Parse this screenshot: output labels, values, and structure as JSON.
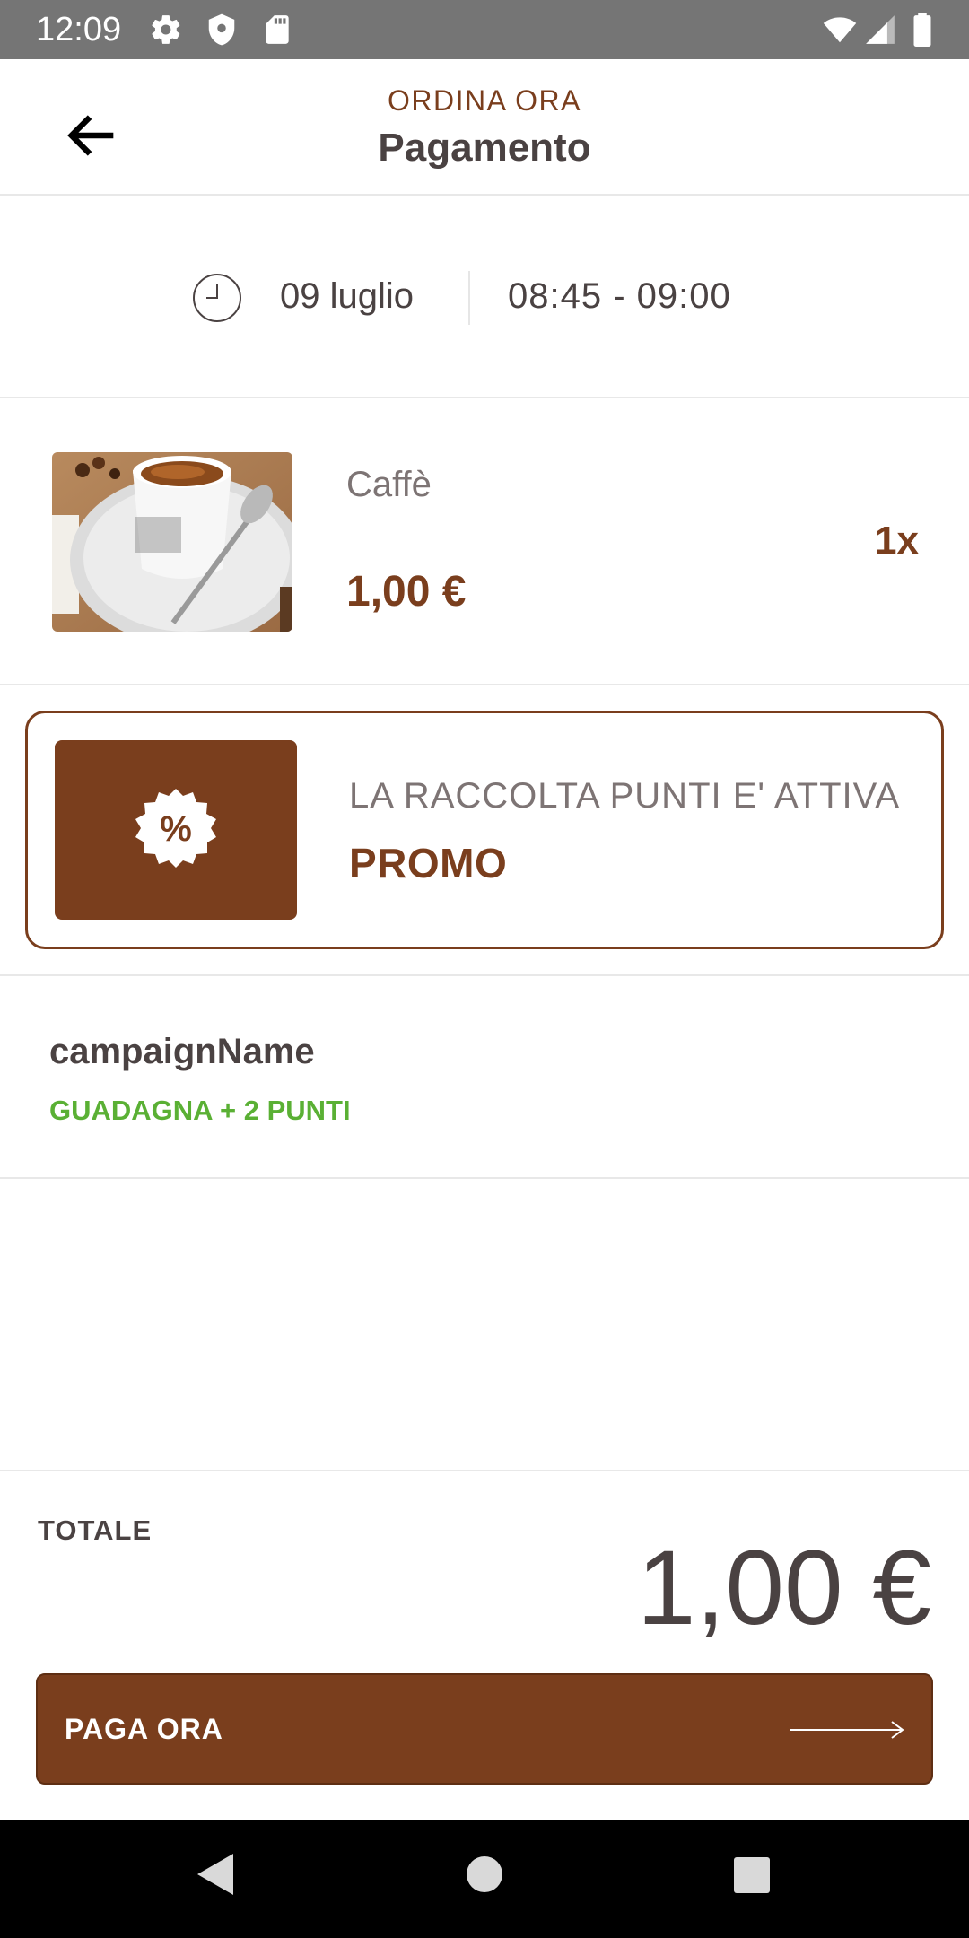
{
  "status_bar": {
    "time": "12:09",
    "left_icons": [
      "gear-icon",
      "shield-icon",
      "sd-card-icon"
    ],
    "right_icons": [
      "wifi-icon",
      "signal-icon",
      "battery-icon"
    ]
  },
  "header": {
    "subtitle": "ORDINA ORA",
    "title": "Pagamento",
    "back_icon": "arrow-left-icon"
  },
  "timeslot": {
    "icon": "clock-icon",
    "date": "09 luglio",
    "time": "08:45 - 09:00"
  },
  "product": {
    "name": "Caffè",
    "price": "1,00 €",
    "quantity": "1x"
  },
  "promo": {
    "icon": "percent-badge-icon",
    "caption": "LA RACCOLTA PUNTI E' ATTIVA",
    "title": "PROMO"
  },
  "campaign": {
    "name": "campaignName",
    "points": "GUADAGNA + 2 PUNTI"
  },
  "footer": {
    "total_label": "TOTALE",
    "total_value": "1,00 €",
    "pay_label": "PAGA ORA",
    "pay_icon": "long-arrow-right-icon"
  },
  "colors": {
    "brand": "#7a3e1d",
    "success": "#5ab034",
    "text": "#4a4242",
    "status_bar": "#757575"
  }
}
